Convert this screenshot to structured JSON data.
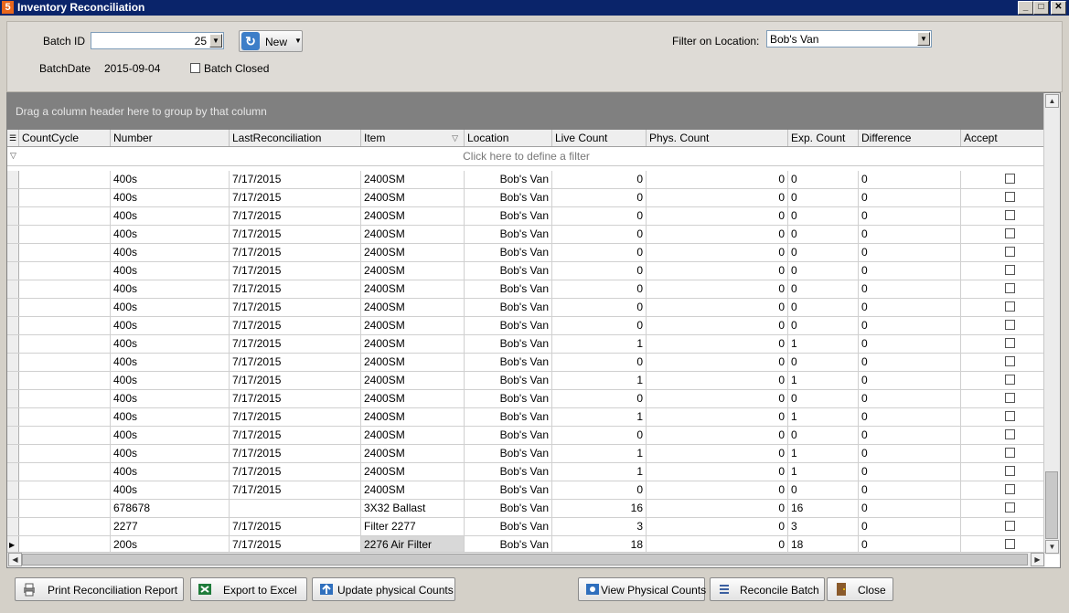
{
  "window": {
    "title": "Inventory Reconciliation",
    "app_icon": "5"
  },
  "batch": {
    "batch_id_label": "Batch ID",
    "batch_id_value": "25",
    "new_label": "New",
    "batchdate_label": "BatchDate",
    "batchdate_value": "2015-09-04",
    "batch_closed_label": "Batch Closed",
    "batch_closed": false
  },
  "filter": {
    "label": "Filter on Location:",
    "value": "Bob's Van"
  },
  "grid": {
    "group_hint": "Drag a column header here to group by that column",
    "filter_hint": "Click here to define a filter",
    "columns": [
      "CountCycle",
      "Number",
      "LastReconciliation",
      "Item",
      "Location",
      "Live Count",
      "Phys. Count",
      "Exp. Count",
      "Difference",
      "Accept"
    ],
    "rows": [
      {
        "count_cycle": "",
        "number": "400s",
        "last": "7/17/2015",
        "item": "2400SM",
        "location": "Bob's Van",
        "live": "0",
        "phys": "0",
        "exp": "0",
        "diff": "0"
      },
      {
        "count_cycle": "",
        "number": "400s",
        "last": "7/17/2015",
        "item": "2400SM",
        "location": "Bob's Van",
        "live": "0",
        "phys": "0",
        "exp": "0",
        "diff": "0"
      },
      {
        "count_cycle": "",
        "number": "400s",
        "last": "7/17/2015",
        "item": "2400SM",
        "location": "Bob's Van",
        "live": "0",
        "phys": "0",
        "exp": "0",
        "diff": "0"
      },
      {
        "count_cycle": "",
        "number": "400s",
        "last": "7/17/2015",
        "item": "2400SM",
        "location": "Bob's Van",
        "live": "0",
        "phys": "0",
        "exp": "0",
        "diff": "0"
      },
      {
        "count_cycle": "",
        "number": "400s",
        "last": "7/17/2015",
        "item": "2400SM",
        "location": "Bob's Van",
        "live": "0",
        "phys": "0",
        "exp": "0",
        "diff": "0"
      },
      {
        "count_cycle": "",
        "number": "400s",
        "last": "7/17/2015",
        "item": "2400SM",
        "location": "Bob's Van",
        "live": "0",
        "phys": "0",
        "exp": "0",
        "diff": "0"
      },
      {
        "count_cycle": "",
        "number": "400s",
        "last": "7/17/2015",
        "item": "2400SM",
        "location": "Bob's Van",
        "live": "0",
        "phys": "0",
        "exp": "0",
        "diff": "0"
      },
      {
        "count_cycle": "",
        "number": "400s",
        "last": "7/17/2015",
        "item": "2400SM",
        "location": "Bob's Van",
        "live": "0",
        "phys": "0",
        "exp": "0",
        "diff": "0"
      },
      {
        "count_cycle": "",
        "number": "400s",
        "last": "7/17/2015",
        "item": "2400SM",
        "location": "Bob's Van",
        "live": "0",
        "phys": "0",
        "exp": "0",
        "diff": "0"
      },
      {
        "count_cycle": "",
        "number": "400s",
        "last": "7/17/2015",
        "item": "2400SM",
        "location": "Bob's Van",
        "live": "1",
        "phys": "0",
        "exp": "1",
        "diff": "0"
      },
      {
        "count_cycle": "",
        "number": "400s",
        "last": "7/17/2015",
        "item": "2400SM",
        "location": "Bob's Van",
        "live": "0",
        "phys": "0",
        "exp": "0",
        "diff": "0"
      },
      {
        "count_cycle": "",
        "number": "400s",
        "last": "7/17/2015",
        "item": "2400SM",
        "location": "Bob's Van",
        "live": "1",
        "phys": "0",
        "exp": "1",
        "diff": "0"
      },
      {
        "count_cycle": "",
        "number": "400s",
        "last": "7/17/2015",
        "item": "2400SM",
        "location": "Bob's Van",
        "live": "0",
        "phys": "0",
        "exp": "0",
        "diff": "0"
      },
      {
        "count_cycle": "",
        "number": "400s",
        "last": "7/17/2015",
        "item": "2400SM",
        "location": "Bob's Van",
        "live": "1",
        "phys": "0",
        "exp": "1",
        "diff": "0"
      },
      {
        "count_cycle": "",
        "number": "400s",
        "last": "7/17/2015",
        "item": "2400SM",
        "location": "Bob's Van",
        "live": "0",
        "phys": "0",
        "exp": "0",
        "diff": "0"
      },
      {
        "count_cycle": "",
        "number": "400s",
        "last": "7/17/2015",
        "item": "2400SM",
        "location": "Bob's Van",
        "live": "1",
        "phys": "0",
        "exp": "1",
        "diff": "0"
      },
      {
        "count_cycle": "",
        "number": "400s",
        "last": "7/17/2015",
        "item": "2400SM",
        "location": "Bob's Van",
        "live": "1",
        "phys": "0",
        "exp": "1",
        "diff": "0"
      },
      {
        "count_cycle": "",
        "number": "400s",
        "last": "7/17/2015",
        "item": "2400SM",
        "location": "Bob's Van",
        "live": "0",
        "phys": "0",
        "exp": "0",
        "diff": "0"
      },
      {
        "count_cycle": "",
        "number": "678678",
        "last": "",
        "item": "3X32 Ballast",
        "location": "Bob's Van",
        "live": "16",
        "phys": "0",
        "exp": "16",
        "diff": "0"
      },
      {
        "count_cycle": "",
        "number": "2277",
        "last": "7/17/2015",
        "item": "Filter 2277",
        "location": "Bob's Van",
        "live": "3",
        "phys": "0",
        "exp": "3",
        "diff": "0"
      },
      {
        "count_cycle": "",
        "number": "200s",
        "last": "7/17/2015",
        "item": "2276 Air Filter",
        "location": "Bob's Van",
        "live": "18",
        "phys": "0",
        "exp": "18",
        "diff": "0",
        "current": true
      }
    ]
  },
  "footer": {
    "print_report": "Print Reconciliation Report",
    "export_excel": "Export to Excel",
    "update_counts": "Update physical Counts",
    "view_counts": "View Physical Counts",
    "reconcile": "Reconcile Batch",
    "close": "Close"
  }
}
